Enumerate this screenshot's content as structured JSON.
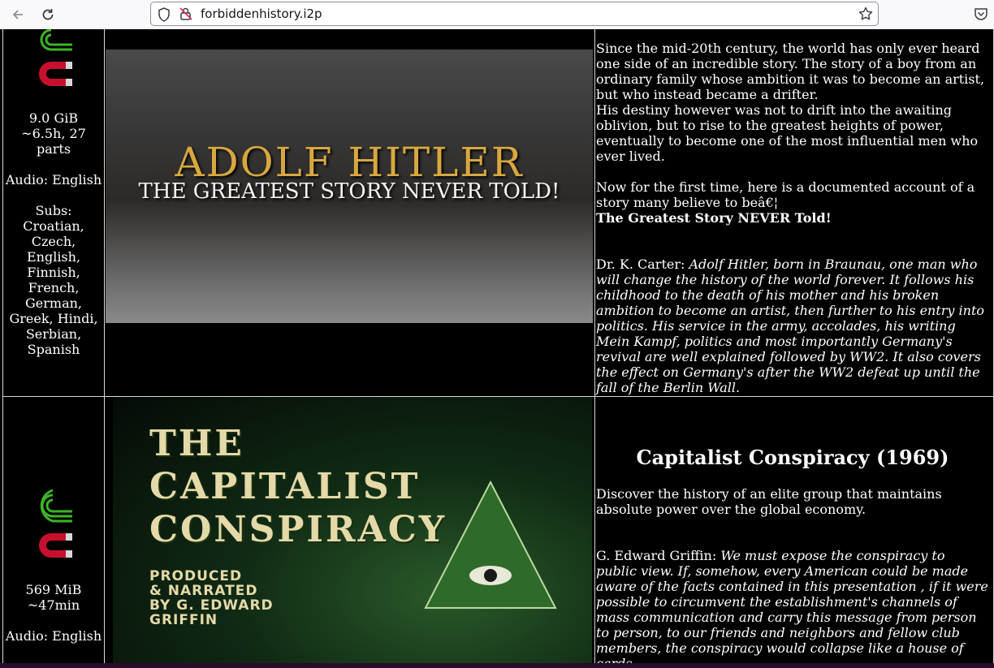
{
  "browser": {
    "url": "forbiddenhistory.i2p"
  },
  "row1": {
    "size": "9.0 GiB",
    "duration": "~6.5h, 27 parts",
    "audio": "Audio: English",
    "subs_label": "Subs:",
    "subs": "Croatian, Czech, English, Finnish, French, German, Greek, Hindi, Serbian, Spanish",
    "thumb_title": "ADOLF HITLER",
    "thumb_subtitle": "THE GREATEST STORY NEVER TOLD!",
    "desc_p1": "Since the mid-20th century, the world has only ever heard one side of an incredible story. The story of a boy from an ordinary family whose ambition it was to become an artist, but who instead became a drifter.",
    "desc_p2": "His destiny however was not to drift into the awaiting oblivion, but to rise to the greatest heights of power, eventually to become one of the most influential men who ever lived.",
    "desc_p3": "Now for the first time, here is a documented account of a story many believe to beâ€¦",
    "desc_bold": "The Greatest Story NEVER Told!",
    "review_author": "Dr. K. Carter:",
    "review_text": "Adolf Hitler, born in Braunau, one man who will change the history of the world forever. It follows his childhood to the death of his mother and his broken ambition to become an artist, then further to his entry into politics. His service in the army, accolades, his writing Mein Kampf, politics and most importantly Germany's revival are well explained followed by WW2. It also covers the effect on Germany's after the WW2 defeat up until the fall of the Berlin Wall."
  },
  "row2": {
    "size": "569 MiB",
    "duration": "~47min",
    "audio": "Audio: English",
    "thumb_line1": "THE",
    "thumb_line2": "CAPITALIST",
    "thumb_line3": "CONSPIRACY",
    "thumb_credit1": "PRODUCED",
    "thumb_credit2": "& NARRATED",
    "thumb_credit3": "BY G. EDWARD",
    "thumb_credit4": "GRIFFIN",
    "title": "Capitalist Conspiracy (1969)",
    "desc_p1": "Discover the history of an elite group that maintains absolute power over the global economy.",
    "review_author": "G. Edward Griffin:",
    "review_text": "We must expose the conspiracy to public view. If, somehow, every American could be made aware of the facts contained in this presentation , if it were possible to circumvent the establishment's channels of mass communication and carry this message from person to person, to our friends and neighbors and fellow club members, the conspiracy would collapse like a house of cards."
  },
  "colors": {
    "background": "#000000",
    "text": "#ffffff",
    "border": "#d8d8d8",
    "icon_green": "#3cb526",
    "icon_red": "#c8102e"
  },
  "icons": [
    "back-arrow-icon",
    "reload-icon",
    "shield-icon",
    "insecure-lock-icon",
    "bookmark-star-icon",
    "pocket-icon",
    "i2p-snark-icon",
    "magnet-icon"
  ]
}
